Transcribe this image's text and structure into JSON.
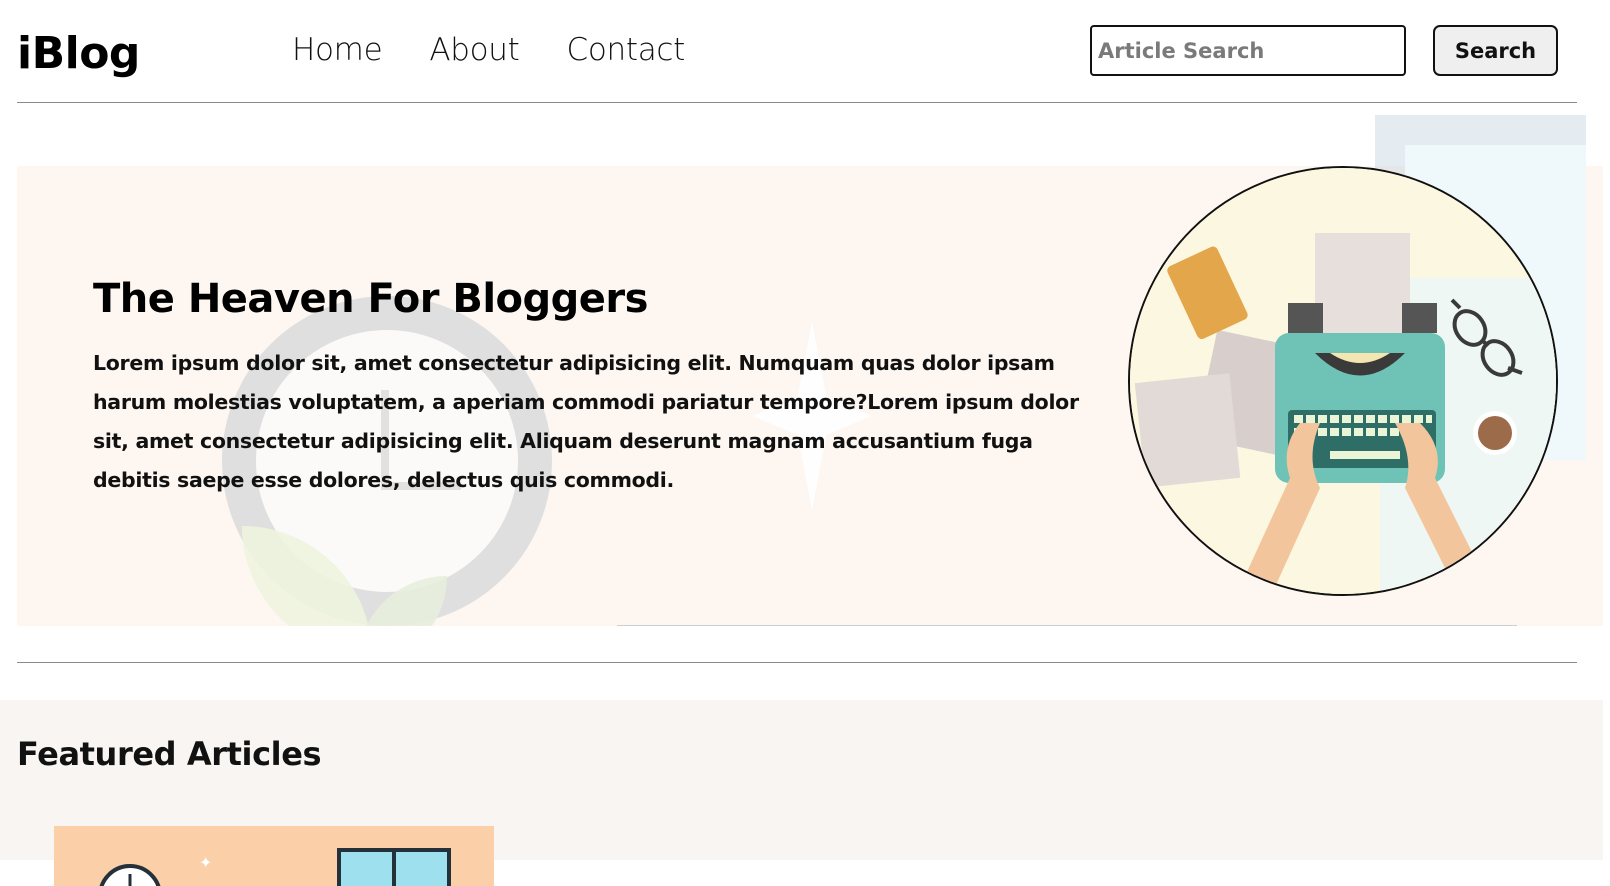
{
  "header": {
    "brand": "iBlog",
    "nav": [
      "Home",
      "About",
      "Contact"
    ],
    "search": {
      "placeholder": "Article Search",
      "value": "",
      "button_label": "Search"
    }
  },
  "hero": {
    "title": "The Heaven For Bloggers",
    "text": "Lorem ipsum dolor sit, amet consectetur adipisicing elit. Numquam quas dolor ipsam harum molestias voluptatem, a aperiam commodi pariatur tempore?Lorem ipsum dolor sit, amet consectetur adipisicing elit. Aliquam deserunt magnam accusantium fuga debitis saepe esse dolores, delectus quis commodi."
  },
  "featured": {
    "title": "Featured Articles"
  },
  "colors": {
    "hero_background": "#fdf6f1",
    "featured_background": "#f9f5f3",
    "typewriter": "#6ec3b6",
    "thumbnail": "#fbd0a8"
  },
  "icons": {
    "hero_illustration": "typewriter-illustration",
    "thumbnail_clock": "clock-icon",
    "thumbnail_window": "window-icon"
  }
}
